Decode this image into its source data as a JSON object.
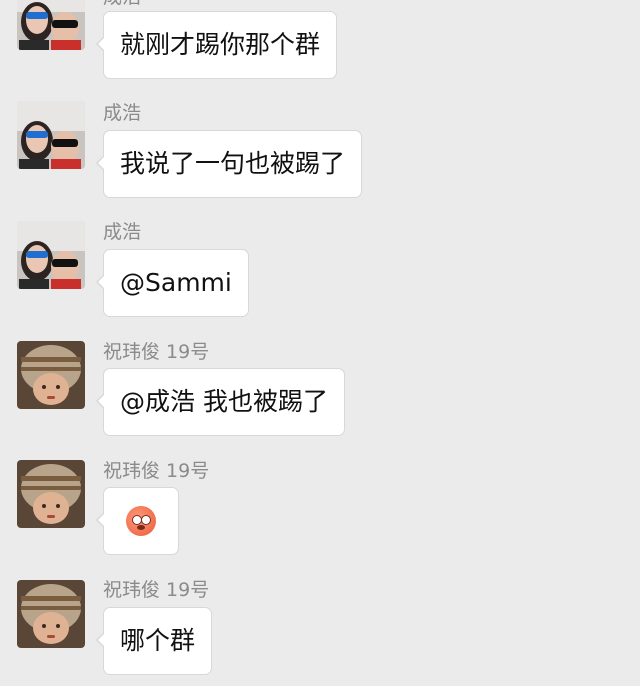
{
  "messages": [
    {
      "sender": "成浩",
      "text": "就刚才踢你那个群",
      "avatar": "couple-photo-avatar"
    },
    {
      "sender": "成浩",
      "text": "我说了一句也被踢了",
      "avatar": "couple-photo-avatar"
    },
    {
      "sender": "成浩",
      "text": "@Sammi",
      "avatar": "couple-photo-avatar"
    },
    {
      "sender": "祝玮俊 19号",
      "text": "@成浩 我也被踢了",
      "avatar": "child-hat-photo-avatar"
    },
    {
      "sender": "祝玮俊 19号",
      "emoji": "flushed-face-emoji",
      "avatar": "child-hat-photo-avatar"
    },
    {
      "sender": "祝玮俊 19号",
      "text": "哪个群",
      "avatar": "child-hat-photo-avatar"
    }
  ],
  "colors": {
    "background": "#ebebeb",
    "bubble": "#ffffff",
    "sender_text": "#8b8b8b"
  }
}
